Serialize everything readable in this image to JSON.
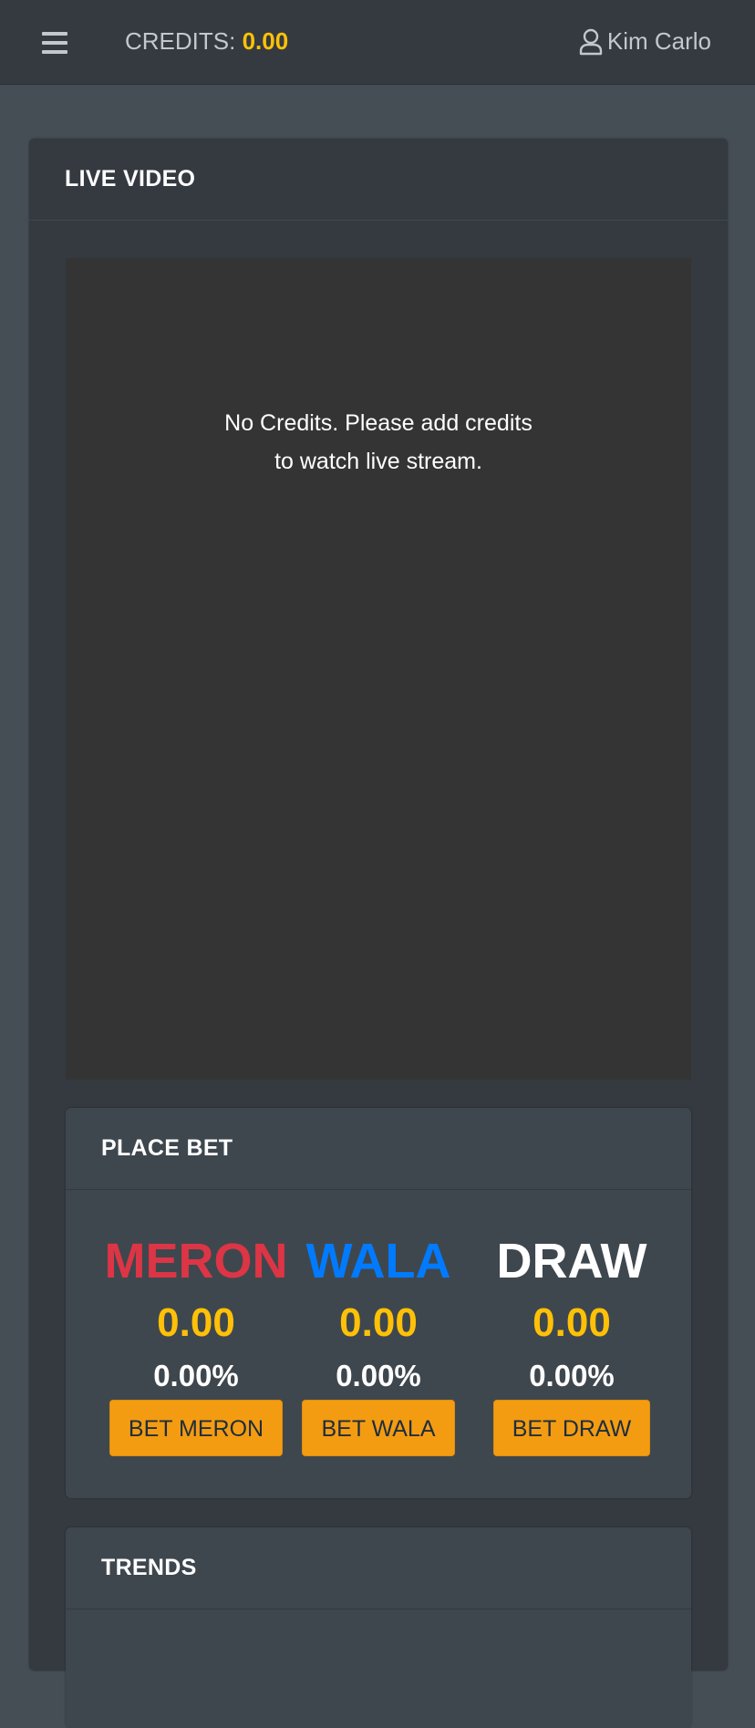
{
  "navbar": {
    "menu_icon": "hamburger-icon",
    "credits_label": "CREDITS:",
    "credits_value": "0.00",
    "user_icon": "user-icon",
    "user_name": "Kim Carlo"
  },
  "live_video": {
    "title": "LIVE VIDEO",
    "message_line1": "No Credits. Please add credits",
    "message_line2": "to watch live stream."
  },
  "place_bet": {
    "title": "PLACE BET",
    "options": [
      {
        "name": "MERON",
        "amount": "0.00",
        "percent": "0.00%",
        "button": "BET MERON",
        "color": "#dc3545"
      },
      {
        "name": "WALA",
        "amount": "0.00",
        "percent": "0.00%",
        "button": "BET WALA",
        "color": "#007bff"
      },
      {
        "name": "DRAW",
        "amount": "0.00",
        "percent": "0.00%",
        "button": "BET DRAW",
        "color": "#ffffff"
      }
    ]
  },
  "trends": {
    "title": "TRENDS"
  },
  "colors": {
    "accent_yellow": "#ffc107",
    "button_orange": "#f39c12",
    "navbar_bg": "#343a40",
    "page_bg": "#454d55"
  }
}
